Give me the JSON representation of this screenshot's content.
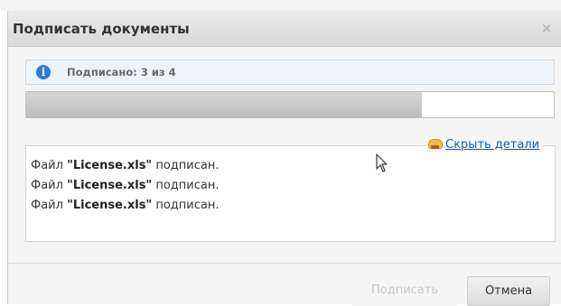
{
  "dialog": {
    "title": "Подписать документы",
    "close_glyph": "×"
  },
  "status": {
    "icon": "info-icon",
    "text": "Подписано: 3 из 4"
  },
  "progress": {
    "signed": 3,
    "total": 4
  },
  "details": {
    "toggle_label": "Скрыть детали",
    "toggle_icon": "hide-details-icon",
    "log": [
      {
        "prefix": "Файл ",
        "file": "\"License.xls\"",
        "suffix": " подписан."
      },
      {
        "prefix": "Файл ",
        "file": "\"License.xls\"",
        "suffix": " подписан."
      },
      {
        "prefix": "Файл ",
        "file": "\"License.xls\"",
        "suffix": " подписан."
      }
    ]
  },
  "buttons": {
    "sign_label": "Подписать",
    "cancel_label": "Отмена"
  },
  "colors": {
    "link": "#1c5fb0",
    "info": "#2e7bd6",
    "progress_fill": "#c8c8c8"
  }
}
